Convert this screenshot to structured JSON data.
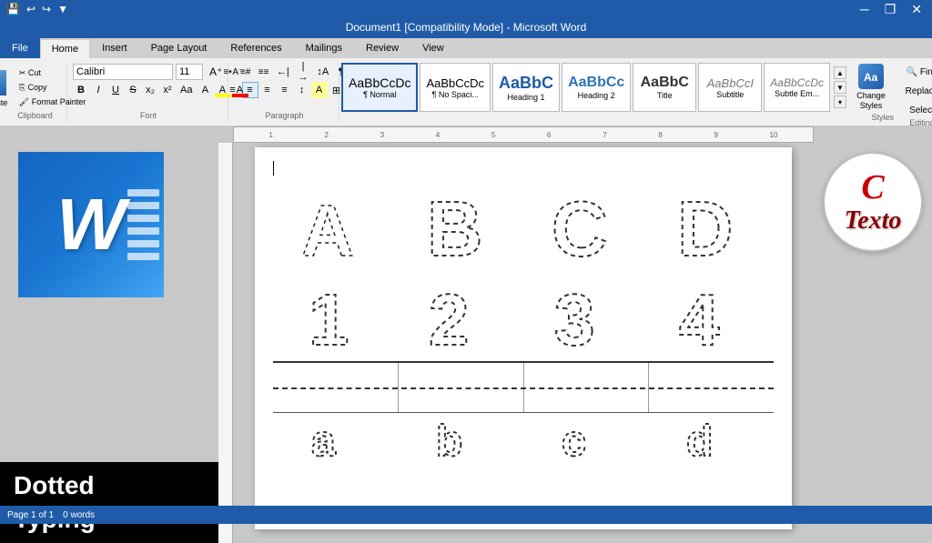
{
  "titlebar": {
    "title": "Document1 [Compatibility Mode] - Microsoft Word",
    "qat_buttons": [
      "save",
      "undo",
      "redo",
      "dropdown"
    ],
    "window_controls": [
      "minimize",
      "restore",
      "close"
    ]
  },
  "ribbon": {
    "tabs": [
      "File",
      "Home",
      "Insert",
      "Page Layout",
      "References",
      "Mailings",
      "Review",
      "View"
    ],
    "active_tab": "Home",
    "groups": {
      "clipboard": {
        "label": "Clipboard",
        "paste": "Paste",
        "cut": "Cut",
        "copy": "Copy",
        "format_painter": "Format Painter"
      },
      "font": {
        "label": "Font",
        "name": "Calibri",
        "size": "11",
        "buttons": [
          "B",
          "I",
          "U",
          "S",
          "x₂",
          "x²",
          "Aa",
          "A",
          "clear"
        ]
      },
      "paragraph": {
        "label": "Paragraph",
        "buttons": [
          "bullets",
          "numbering",
          "multilevel",
          "decrease-indent",
          "increase-indent",
          "sort",
          "show-marks",
          "align-left",
          "center",
          "align-right",
          "justify",
          "line-spacing",
          "shading",
          "borders"
        ]
      },
      "styles": {
        "label": "Styles",
        "items": [
          {
            "id": "normal",
            "label": "¶ Normal",
            "text_preview": "AaBbCcDc",
            "active": true
          },
          {
            "id": "no-spacing",
            "label": "¶ No Spaci...",
            "text_preview": "AaBbCcDc"
          },
          {
            "id": "heading1",
            "label": "Heading 1",
            "text_preview": "AaBbC"
          },
          {
            "id": "heading2",
            "label": "Heading 2",
            "text_preview": "AaBbCc"
          },
          {
            "id": "title",
            "label": "Title",
            "text_preview": "AaBbC"
          },
          {
            "id": "subtitle",
            "label": "Subtitle",
            "text_preview": "AaBbCcI"
          },
          {
            "id": "subtle-em",
            "label": "Subtle Em...",
            "text_preview": "AaBbCcDc"
          }
        ],
        "change_styles": "Change\nStyles"
      },
      "editing": {
        "label": "Editing"
      }
    }
  },
  "document": {
    "letters": [
      "A",
      "B",
      "C",
      "D"
    ],
    "numbers": [
      "1",
      "2",
      "3",
      "4"
    ],
    "lowercase": [
      "a",
      "b",
      "c",
      "d"
    ]
  },
  "left_panel": {
    "logo_text": "W",
    "banner_line1": "Dotted",
    "banner_line2": "Typing"
  },
  "right_panel": {
    "logo_c": "C",
    "logo_texto": "Texto"
  },
  "status_bar": {
    "page": "Page 1 of 1",
    "words": "0 words"
  }
}
